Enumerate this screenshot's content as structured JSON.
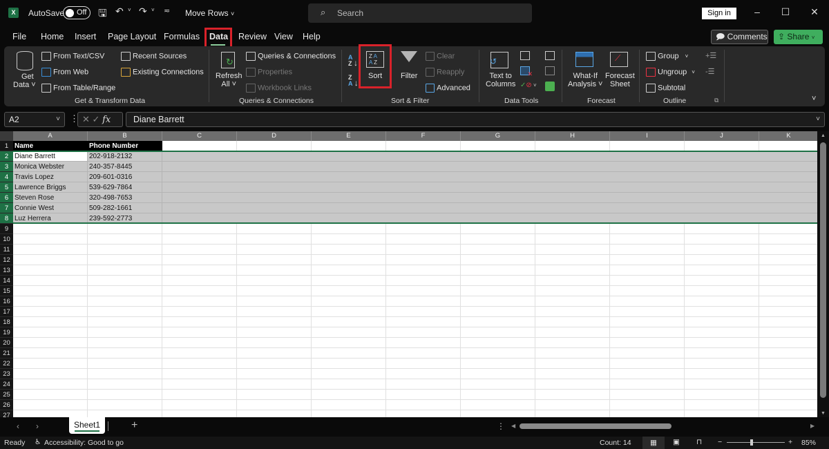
{
  "titlebar": {
    "app_icon": "excel-logo-icon",
    "app_letter": "X",
    "autosave_label": "AutoSave",
    "autosave_state": "Off",
    "document_title": "Move Rows",
    "search_placeholder": "Search",
    "sign_in": "Sign in",
    "minimize": "–",
    "maximize": "☐",
    "close": "✕"
  },
  "menu": {
    "tabs": [
      "File",
      "Home",
      "Insert",
      "Page Layout",
      "Formulas",
      "Data",
      "Review",
      "View",
      "Help"
    ],
    "active_tab": "Data",
    "comments": "Comments",
    "share": "Share"
  },
  "ribbon": {
    "get_transform": {
      "get_data": [
        "Get",
        "Data ˅"
      ],
      "from_text_csv": "From Text/CSV",
      "from_web": "From Web",
      "from_table_range": "From Table/Range",
      "recent_sources": "Recent Sources",
      "existing_connections": "Existing Connections",
      "group_label": "Get & Transform Data"
    },
    "queries": {
      "refresh_all": [
        "Refresh",
        "All ˅"
      ],
      "queries_connections": "Queries & Connections",
      "properties": "Properties",
      "workbook_links": "Workbook Links",
      "group_label": "Queries & Connections"
    },
    "sort_filter": {
      "sort_az": "A→Z",
      "sort_za": "Z→A",
      "sort": "Sort",
      "filter": "Filter",
      "clear": "Clear",
      "reapply": "Reapply",
      "advanced": "Advanced",
      "group_label": "Sort & Filter"
    },
    "data_tools": {
      "text_to_columns": [
        "Text to",
        "Columns"
      ],
      "group_label": "Data Tools"
    },
    "forecast": {
      "what_if": [
        "What-If",
        "Analysis ˅"
      ],
      "forecast_sheet": [
        "Forecast",
        "Sheet"
      ],
      "group_label": "Forecast"
    },
    "outline": {
      "group": "Group",
      "ungroup": "Ungroup",
      "subtotal": "Subtotal",
      "group_label": "Outline"
    }
  },
  "formula_bar": {
    "name_box": "A2",
    "fx": "fx",
    "cancel": "✕",
    "enter": "✓",
    "value": "Diane Barrett"
  },
  "sheet": {
    "columns": [
      "A",
      "B",
      "C",
      "D",
      "E",
      "F",
      "G",
      "H",
      "I",
      "J",
      "K"
    ],
    "header_row": [
      "Name",
      "Phone Number"
    ],
    "rows": [
      [
        "Diane Barrett",
        "202-918-2132"
      ],
      [
        "Monica Webster",
        "240-357-8445"
      ],
      [
        "Travis Lopez",
        "209-601-0316"
      ],
      [
        "Lawrence Briggs",
        "539-629-7864"
      ],
      [
        "Steven Rose",
        "320-498-7653"
      ],
      [
        "Connie West",
        "509-282-1661"
      ],
      [
        "Luz Herrera",
        "239-592-2773"
      ]
    ],
    "row_numbers": [
      1,
      2,
      3,
      4,
      5,
      6,
      7,
      8,
      9,
      10,
      11,
      12,
      13,
      14,
      15,
      16,
      17,
      18,
      19,
      20,
      21,
      22,
      23,
      24,
      25,
      26,
      27
    ],
    "selected_rows": [
      2,
      3,
      4,
      5,
      6,
      7,
      8
    ],
    "active_cell": "A2"
  },
  "sheet_tabs": {
    "tabs": [
      "Sheet1"
    ],
    "active": "Sheet1",
    "add": "+"
  },
  "status": {
    "ready": "Ready",
    "accessibility": "Accessibility: Good to go",
    "count": "Count: 14",
    "zoom": "85%",
    "zoom_minus": "−",
    "zoom_plus": "+"
  },
  "colors": {
    "accent_green": "#1e7145",
    "share_green": "#3fae5e",
    "highlight_red": "#d9222a",
    "selection_gray": "#c8c8c8"
  }
}
